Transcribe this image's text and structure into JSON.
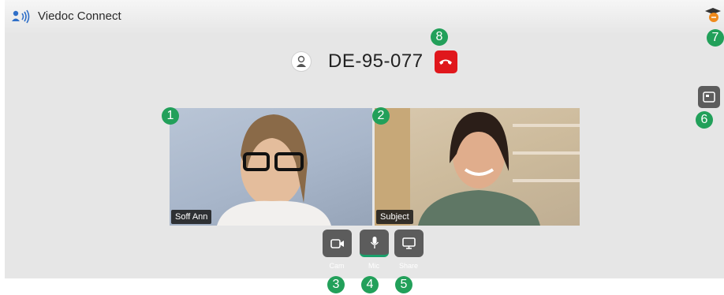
{
  "app": {
    "title": "Viedoc Connect",
    "logo_icon": "speaker-person-icon",
    "help_icon": "graduation-cap-help-icon"
  },
  "call": {
    "subject_id": "DE-95-077",
    "avatar_icon": "person-avatar-icon",
    "hangup_icon": "phone-hangup-icon",
    "hangup_color": "#e0171c"
  },
  "pip": {
    "icon": "picture-in-picture-icon"
  },
  "tiles": [
    {
      "label": "Soff Ann"
    },
    {
      "label": "Subject"
    }
  ],
  "controls": {
    "cam": {
      "label": "Cam",
      "icon": "video-camera-icon"
    },
    "mic": {
      "label": "Mic",
      "icon": "microphone-icon",
      "active_color": "#1aa06b"
    },
    "share": {
      "label": "Share",
      "icon": "monitor-share-icon"
    }
  },
  "badges": {
    "b1": "1",
    "b2": "2",
    "b3": "3",
    "b4": "4",
    "b5": "5",
    "b6": "6",
    "b7": "7",
    "b8": "8",
    "color": "#22a05a"
  }
}
